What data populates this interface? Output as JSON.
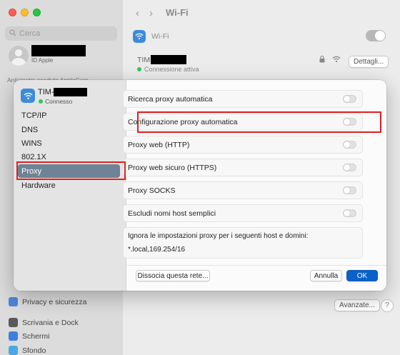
{
  "background": {
    "search_placeholder": "Cerca",
    "apple_id_label": "ID Apple",
    "apple_note": "Anticipato: scaduto AppleCare...",
    "window_title": "Wi-Fi",
    "wifi_label": "Wi-Fi",
    "network_name": "TIM-",
    "network_status": "Connessione attiva",
    "details_button": "Dettagli...",
    "advanced_button": "Avanzate...",
    "help_button": "?",
    "sidebar_items": [
      {
        "label": "Privacy e sicurezza",
        "color": "#4f86d8"
      },
      {
        "label": "Scrivania e Dock",
        "color": "#5a5a5a"
      },
      {
        "label": "Schermi",
        "color": "#3d7fe0"
      },
      {
        "label": "Sfondo",
        "color": "#49a9e6"
      }
    ]
  },
  "sheet": {
    "network_name": "TIM-",
    "network_status": "Connesso",
    "nav": [
      {
        "label": "TCP/IP",
        "selected": false
      },
      {
        "label": "DNS",
        "selected": false
      },
      {
        "label": "WINS",
        "selected": false
      },
      {
        "label": "802.1X",
        "selected": false
      },
      {
        "label": "Proxy",
        "selected": true
      },
      {
        "label": "Hardware",
        "selected": false
      }
    ],
    "options": [
      {
        "label": "Ricerca proxy automatica",
        "enabled": false
      },
      {
        "label": "Configurazione proxy automatica",
        "enabled": false
      },
      {
        "label": "Proxy web (HTTP)",
        "enabled": false
      },
      {
        "label": "Proxy web sicuro (HTTPS)",
        "enabled": false
      },
      {
        "label": "Proxy SOCKS",
        "enabled": false
      },
      {
        "label": "Escludi nomi host semplici",
        "enabled": false
      }
    ],
    "bypass_label": "Ignora le impostazioni proxy per i seguenti host e domini:",
    "bypass_value": "*.local,169.254/16",
    "disconnect_button": "Dissocia questa rete...",
    "cancel_button": "Annulla",
    "ok_button": "OK"
  },
  "colors": {
    "accent": "#0a61c7",
    "selection": "#6e8395",
    "highlight_box": "#e02020",
    "connected": "#34c759"
  }
}
